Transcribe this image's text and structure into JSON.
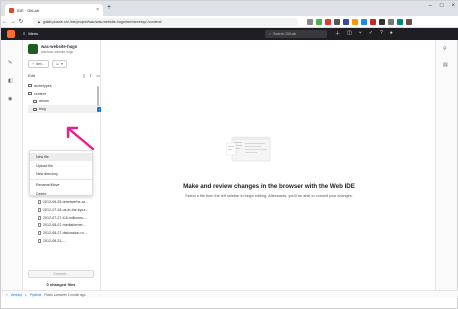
{
  "browser": {
    "tab_title": "IDE · GitLab",
    "tab_close": "×",
    "new_tab": "+",
    "url": "gitlab.puzzle.ch/-/ide/project/wac/wac-website-hugo/tree/develop/-/content/",
    "window_controls": [
      "–",
      "□",
      "×"
    ]
  },
  "gitlab_nav": {
    "menu_label": "Menu",
    "search_placeholder": "Search GitLab"
  },
  "sidebar": {
    "project_name": "wac-website-hugo",
    "project_subtitle": "wac/wac-website-hugo",
    "branch_label": "dev...",
    "edit_label": "Edit",
    "tree": [
      {
        "type": "folder",
        "label": "archetypes",
        "depth": 0
      },
      {
        "type": "folder",
        "label": "content",
        "depth": 0
      },
      {
        "type": "folder",
        "label": "alnum",
        "depth": 1
      },
      {
        "type": "folder",
        "label": "blog",
        "depth": 1,
        "selected": true
      }
    ],
    "files": [
      "2012-03-19-mr-phamer",
      "2012-03-27-mediaformer...",
      "2012-03-28-designing-the...",
      "2012-03-28-mailing",
      "2012-04-16-refresh-to-un...",
      "2012-06-25-retreiwerhe-ar...",
      "2012-07-18-us-in-the-bycz...",
      "2012-07-27-6-6-milliones-...",
      "2012-08-07-mediaformer...",
      "2012-08-27-diskussion-ru...",
      "2012-08-31-..."
    ],
    "commit_label": "Commit...",
    "changed_files": "0 changed files"
  },
  "context_menu": {
    "items": [
      "New file",
      "Upload file",
      "New directory",
      "Rename/Move",
      "Delete"
    ]
  },
  "main": {
    "headline": "Make and review changes in the browser with the Web IDE",
    "subline": "Select a file from the left sidebar to begin editing. Afterwards, you'll be able to commit your changes."
  },
  "status": {
    "branch": "develop",
    "pipeline": "Pipeline",
    "commit_info": "Flavio Loescher 1 month ago"
  },
  "colors": {
    "accent": "#1f75cb",
    "arrow": "#e91e8c",
    "nav_bg": "#1f1e24"
  }
}
